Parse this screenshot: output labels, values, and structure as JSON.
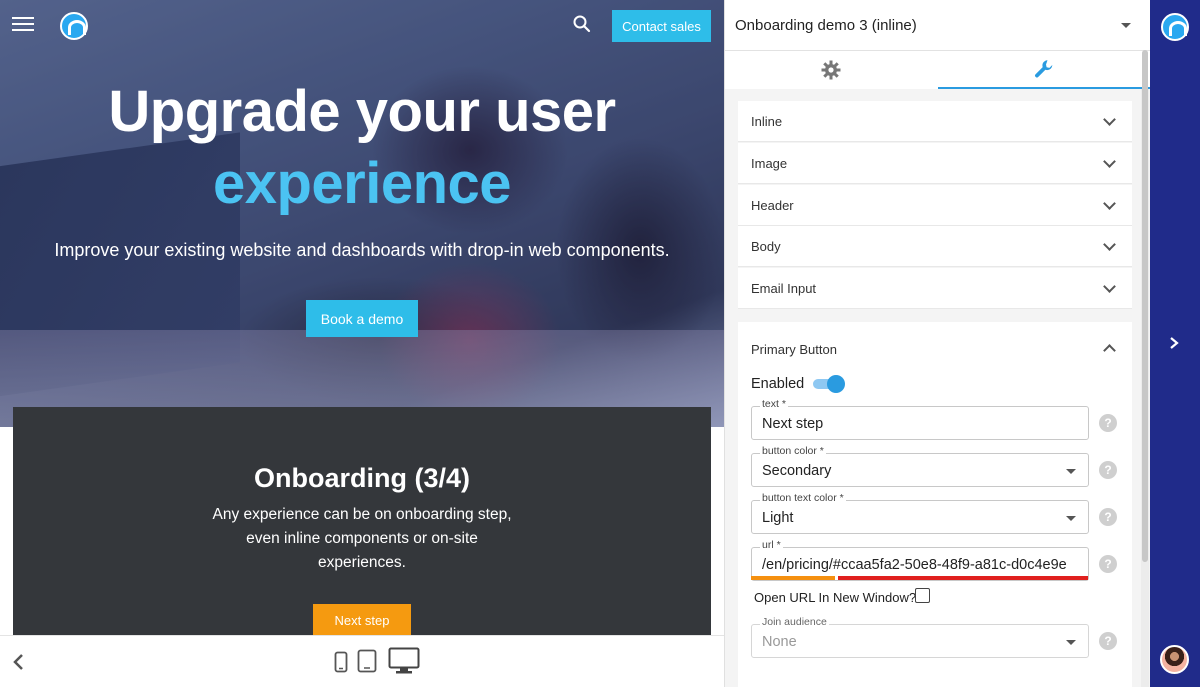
{
  "preview": {
    "nav": {
      "menu_icon": "hamburger-icon",
      "logo_icon": "brand-logo-icon",
      "search_icon": "search-icon",
      "contact_label": "Contact sales"
    },
    "hero": {
      "title_line1": "Upgrade your user",
      "title_line2": "experience",
      "subtitle": "Improve your existing website and dashboards with drop-in web components.",
      "cta_label": "Book a demo"
    },
    "onboarding": {
      "title": "Onboarding (3/4)",
      "body_lines": [
        "Any experience can be on onboarding step,",
        "even inline components or on-site",
        "experiences."
      ],
      "button_label": "Next step"
    },
    "device_bar": {
      "back_icon": "chevron-left-icon",
      "devices": [
        "phone-icon",
        "tablet-icon",
        "desktop-icon"
      ]
    }
  },
  "editor": {
    "demo_select": "Onboarding demo 3 (inline)",
    "tabs": [
      {
        "icon": "gear-icon",
        "active": false
      },
      {
        "icon": "wrench-icon",
        "active": true
      }
    ],
    "sections": [
      {
        "label": "Inline"
      },
      {
        "label": "Image"
      },
      {
        "label": "Header"
      },
      {
        "label": "Body"
      },
      {
        "label": "Email Input"
      }
    ],
    "primary_button": {
      "label": "Primary Button",
      "enabled_label": "Enabled",
      "enabled": true,
      "fields": {
        "text": {
          "label": "text *",
          "value": "Next step"
        },
        "button_color": {
          "label": "button color *",
          "value": "Secondary"
        },
        "button_text_color": {
          "label": "button text color *",
          "value": "Light"
        },
        "url": {
          "label": "url *",
          "value": "/en/pricing/#ccaa5fa2-50e8-48f9-a81c-d0c4e9e"
        },
        "join_audience": {
          "label": "Join audience",
          "value": "None"
        }
      },
      "open_new_window_label": "Open URL In New Window?",
      "open_new_window": false,
      "help_glyph": "?"
    }
  },
  "colors": {
    "accent": "#2ebde9",
    "next_step": "#f59a10",
    "side_strip": "#202b8a",
    "url_mark_orange": "#f5900f",
    "url_mark_red": "#e0201e"
  }
}
